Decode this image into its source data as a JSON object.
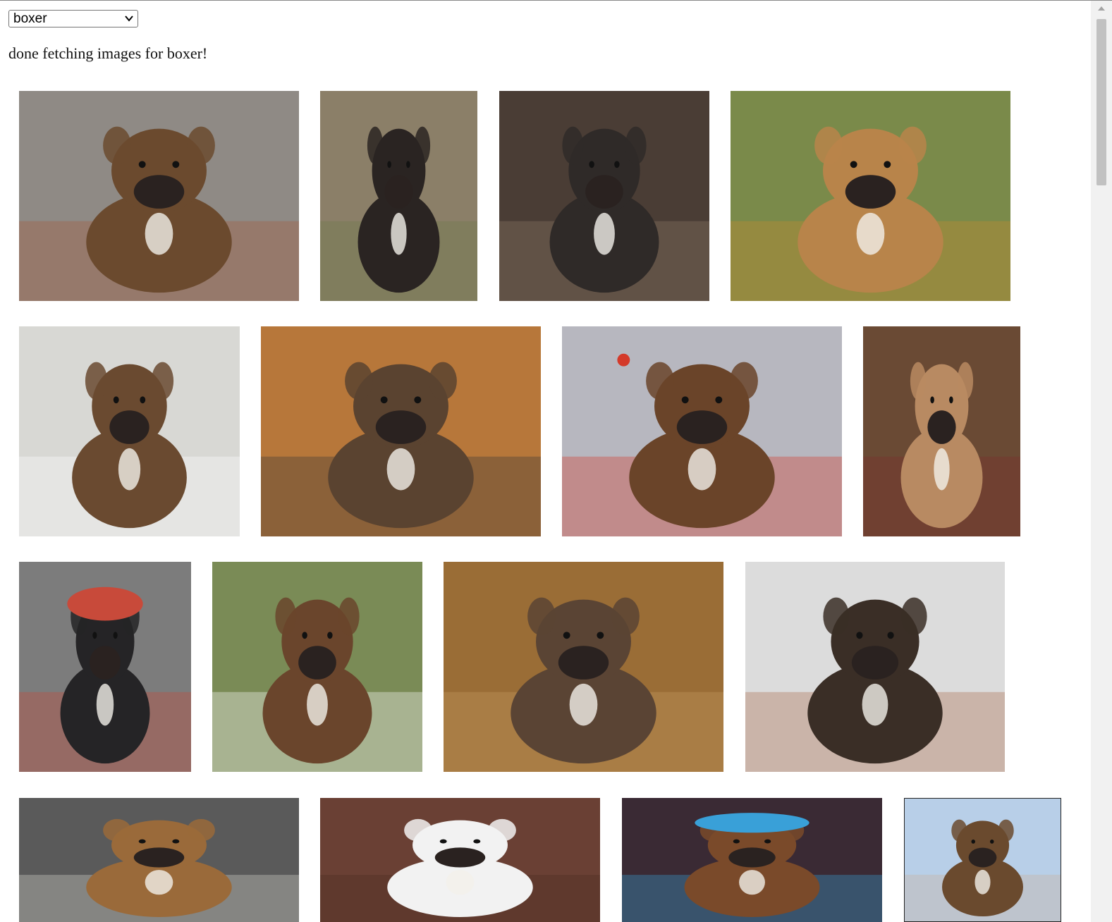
{
  "breed_select": {
    "selected": "boxer"
  },
  "status": {
    "text": "done fetching images for boxer!"
  },
  "gallery": {
    "images": [
      {
        "name": "boxer-image-1",
        "bg": "#8f8a85",
        "dog": "#6b4a2e",
        "accent": "#a45a3c",
        "scene": "brick"
      },
      {
        "name": "boxer-image-2",
        "bg": "#8b7f68",
        "dog": "#2a2422",
        "accent": "#6e7a4a",
        "scene": "grass"
      },
      {
        "name": "boxer-image-3",
        "bg": "#4a3d35",
        "dog": "#2f2a28",
        "accent": "#8d7a66",
        "scene": "couch"
      },
      {
        "name": "boxer-image-4",
        "bg": "#7a8a4a",
        "dog": "#b8844a",
        "accent": "#c9892f",
        "scene": "cushion"
      },
      {
        "name": "boxer-image-5",
        "bg": "#d8d8d4",
        "dog": "#6a4a30",
        "accent": "#ffffff",
        "scene": "patio"
      },
      {
        "name": "boxer-image-6",
        "bg": "#b7773a",
        "dog": "#5a4330",
        "accent": "#3a3a3a",
        "scene": "floor"
      },
      {
        "name": "boxer-image-7",
        "bg": "#b7b7bf",
        "dog": "#6a4429",
        "accent": "#d43a2a",
        "scene": "stone"
      },
      {
        "name": "boxer-image-8",
        "bg": "#6a4a34",
        "dog": "#b88a62",
        "accent": "#7a2e2e",
        "scene": "room"
      },
      {
        "name": "boxer-image-9",
        "bg": "#7c7c7c",
        "dog": "#252426",
        "accent": "#c84a3a",
        "scene": "cap"
      },
      {
        "name": "boxer-image-10",
        "bg": "#7a8b56",
        "dog": "#6a452c",
        "accent": "#ffffff",
        "scene": "face"
      },
      {
        "name": "boxer-image-11",
        "bg": "#9a6d36",
        "dog": "#5a4434",
        "accent": "#c69a62",
        "scene": "pair"
      },
      {
        "name": "boxer-image-12",
        "bg": "#dcdcdc",
        "dog": "#3a2e26",
        "accent": "#a8694a",
        "scene": "tile"
      },
      {
        "name": "boxer-image-13",
        "bg": "#5a5a5a",
        "dog": "#9a6a3a",
        "accent": "#d7d7cf",
        "scene": "closeup"
      },
      {
        "name": "boxer-image-14",
        "bg": "#6a4034",
        "dog": "#f2f2f2",
        "accent": "#4a2e22",
        "scene": "whiteface"
      },
      {
        "name": "boxer-image-15",
        "bg": "#3a2a34",
        "dog": "#7a4a2a",
        "accent": "#39a0d8",
        "scene": "hat"
      },
      {
        "name": "boxer-image-16",
        "bg": "#b8cfe8",
        "dog": "#6a4a2e",
        "accent": "#c8b09a",
        "scene": "sky"
      }
    ]
  }
}
